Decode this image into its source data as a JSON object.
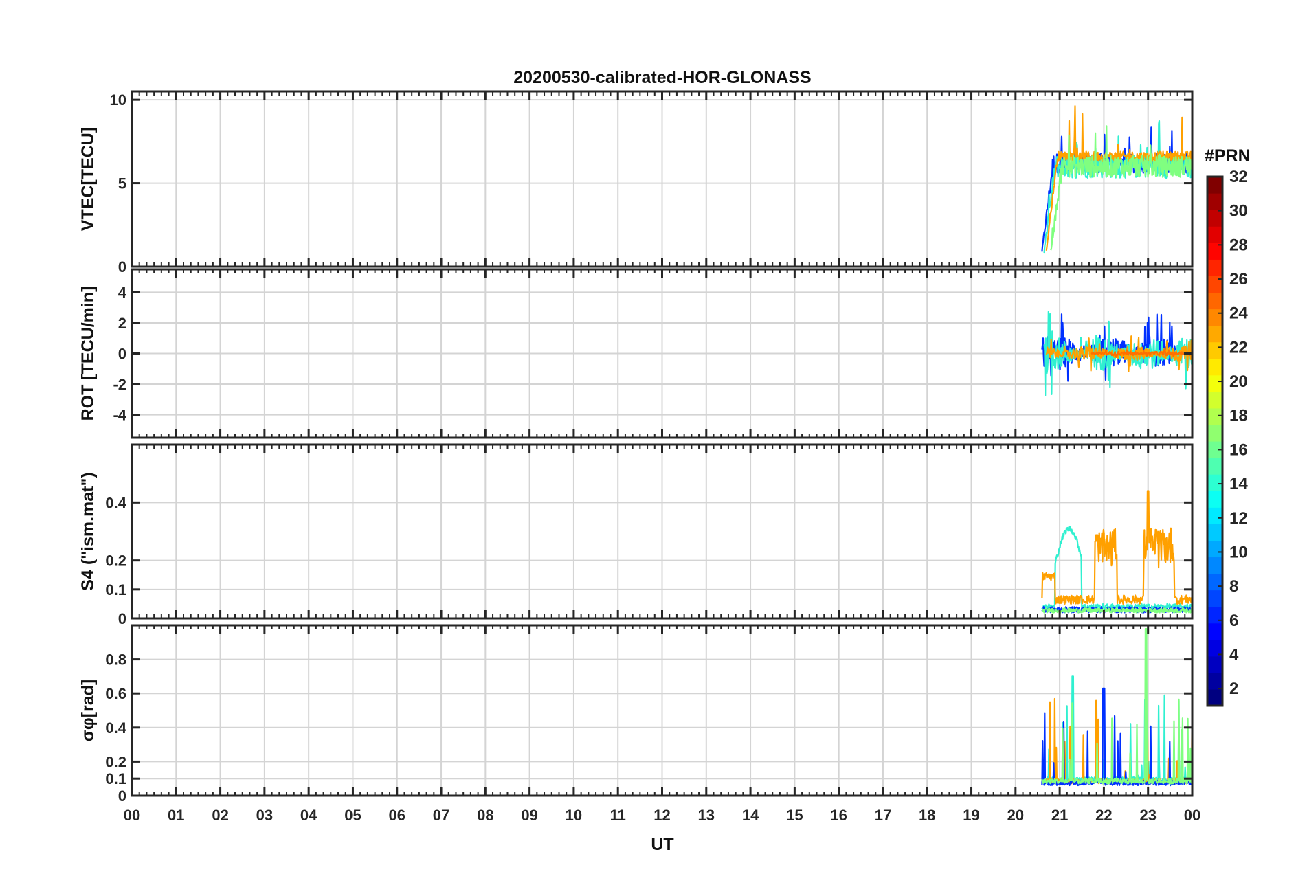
{
  "chart_data": {
    "type": "line",
    "title": "20200530-calibrated-HOR-GLONASS",
    "xlabel": "UT",
    "x_range_hours": [
      0,
      24
    ],
    "x_tick_labels": [
      "00",
      "01",
      "02",
      "03",
      "04",
      "05",
      "06",
      "07",
      "08",
      "09",
      "10",
      "11",
      "12",
      "13",
      "14",
      "15",
      "16",
      "17",
      "18",
      "19",
      "20",
      "21",
      "22",
      "23",
      "00"
    ],
    "x_tick_hours": [
      0,
      1,
      2,
      3,
      4,
      5,
      6,
      7,
      8,
      9,
      10,
      11,
      12,
      13,
      14,
      15,
      16,
      17,
      18,
      19,
      20,
      21,
      22,
      23,
      24
    ],
    "grid": true,
    "colorbar": {
      "label": "#PRN",
      "range": [
        1,
        32
      ],
      "tick_labels": [
        "2",
        "4",
        "6",
        "8",
        "10",
        "12",
        "14",
        "16",
        "18",
        "20",
        "22",
        "24",
        "26",
        "28",
        "30",
        "32"
      ],
      "tick_values": [
        2,
        4,
        6,
        8,
        10,
        12,
        14,
        16,
        18,
        20,
        22,
        24,
        26,
        28,
        30,
        32
      ],
      "colormap": "jet",
      "placement": "right"
    },
    "panels": [
      {
        "id": "vtec",
        "ylabel": "VTEC[TECU]",
        "ylim": [
          0,
          10.5
        ],
        "yticks": [
          0,
          5,
          10
        ],
        "ytick_labels": [
          "0",
          "5",
          "10"
        ],
        "series": [
          {
            "prn": 5,
            "color": "#0030ff",
            "kind": "vtec",
            "start": 20.6,
            "end": 24.0,
            "base": 6.2,
            "noise": 1.2,
            "rise": true
          },
          {
            "prn": 13,
            "color": "#30f0d0",
            "kind": "vtec",
            "start": 20.65,
            "end": 24.0,
            "base": 6.0,
            "noise": 1.4,
            "rise": true
          },
          {
            "prn": 22,
            "color": "#ffa000",
            "kind": "vtec",
            "start": 20.7,
            "end": 24.0,
            "base": 6.6,
            "noise": 0.6,
            "rise": true
          },
          {
            "prn": 16,
            "color": "#80ff80",
            "kind": "vtec",
            "start": 20.8,
            "end": 24.0,
            "base": 6.0,
            "noise": 1.3,
            "rise": true
          }
        ]
      },
      {
        "id": "rot",
        "ylabel": "ROT [TECU/min]",
        "ylim": [
          -5.5,
          5.5
        ],
        "yticks": [
          -4,
          -2,
          0,
          2,
          4
        ],
        "ytick_labels": [
          "-4",
          "-2",
          "0",
          "2",
          "4"
        ],
        "series": [
          {
            "prn": 5,
            "color": "#0030ff",
            "kind": "rot",
            "start": 20.6,
            "end": 24.0,
            "base": 0.1,
            "noise": 2.4
          },
          {
            "prn": 13,
            "color": "#30f0d0",
            "kind": "rot",
            "start": 20.65,
            "end": 24.0,
            "base": 0.0,
            "noise": 2.8
          },
          {
            "prn": 22,
            "color": "#ffa000",
            "kind": "rot",
            "start": 20.7,
            "end": 24.0,
            "base": 0.0,
            "noise": 1.2
          },
          {
            "prn": 24,
            "color": "#ff7000",
            "kind": "rot",
            "start": 21.7,
            "end": 24.0,
            "base": 0.0,
            "noise": 0.3
          }
        ]
      },
      {
        "id": "s4",
        "ylabel": "S4 (\"ism.mat\")",
        "ylim": [
          0,
          0.6
        ],
        "yticks": [
          0,
          0.1,
          0.2,
          0.4
        ],
        "ytick_labels": [
          "0",
          "0.1",
          "0.2",
          "0.4"
        ],
        "series": [
          {
            "prn": 13,
            "color": "#30f0d0",
            "kind": "s4",
            "start": 20.6,
            "end": 24.0,
            "base": 0.03,
            "noise": 0.02
          },
          {
            "prn": 22,
            "color": "#ffa000",
            "kind": "s4",
            "start": 20.6,
            "end": 24.0,
            "base": 0.05,
            "noise": 0.03
          },
          {
            "prn": 5,
            "color": "#0030ff",
            "kind": "s4",
            "start": 20.6,
            "end": 24.0,
            "base": 0.02,
            "noise": 0.02
          },
          {
            "prn": 16,
            "color": "#80ff80",
            "kind": "s4",
            "start": 20.6,
            "end": 24.0,
            "base": 0.02,
            "noise": 0.015
          }
        ]
      },
      {
        "id": "sigphi",
        "ylabel": "σφ[rad]",
        "ylim": [
          0,
          1.0
        ],
        "yticks": [
          0,
          0.1,
          0.2,
          0.4,
          0.6,
          0.8
        ],
        "ytick_labels": [
          "0",
          "0.1",
          "0.2",
          "0.4",
          "0.6",
          "0.8"
        ],
        "series": [
          {
            "prn": 13,
            "color": "#30f0d0",
            "kind": "sig",
            "start": 20.6,
            "end": 24.0,
            "base": 0.08,
            "noise": 0.03
          },
          {
            "prn": 22,
            "color": "#ffa000",
            "kind": "sig",
            "start": 20.6,
            "end": 24.0,
            "base": 0.07,
            "noise": 0.03
          },
          {
            "prn": 5,
            "color": "#0030ff",
            "kind": "sig",
            "start": 20.6,
            "end": 24.0,
            "base": 0.06,
            "noise": 0.03
          },
          {
            "prn": 16,
            "color": "#80ff80",
            "kind": "sig",
            "start": 20.6,
            "end": 24.0,
            "base": 0.07,
            "noise": 0.03
          }
        ]
      }
    ]
  }
}
